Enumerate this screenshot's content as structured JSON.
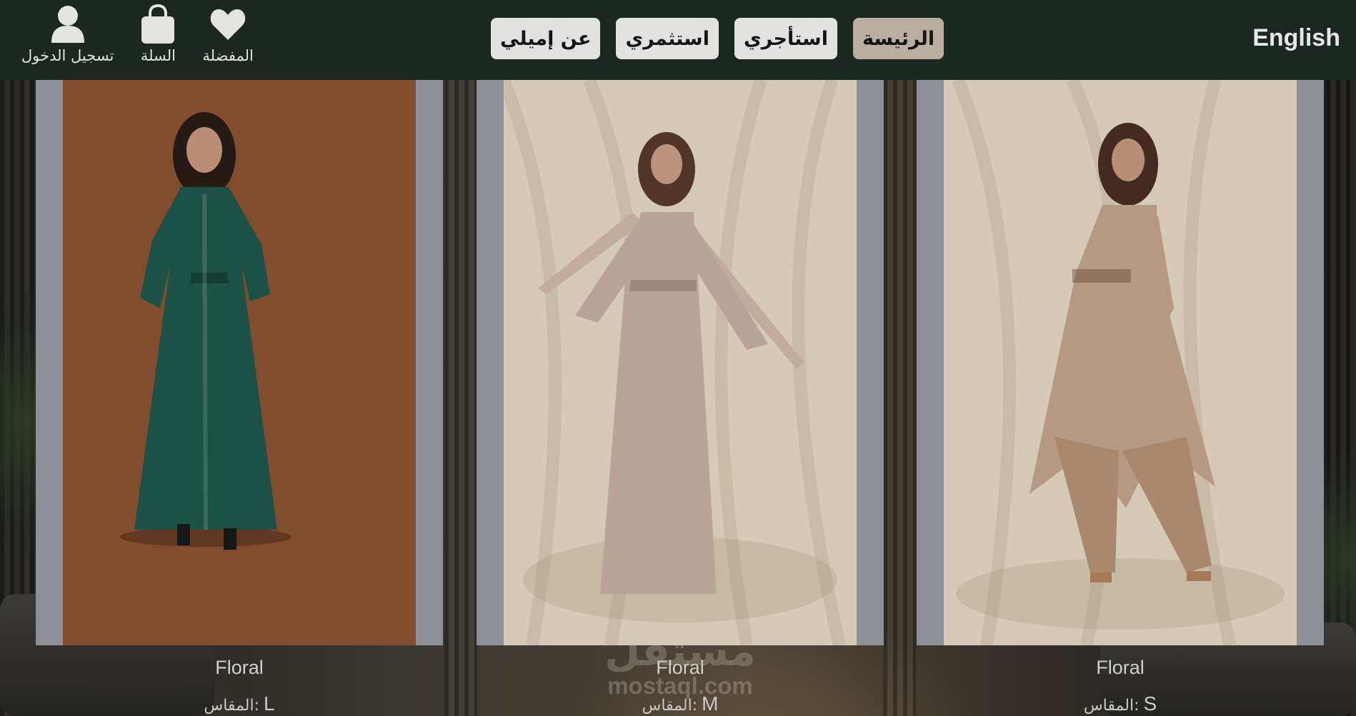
{
  "nav": {
    "favorites_label": "المفضلة",
    "cart_label": "السلة",
    "login_label": "تسجيل الدخول",
    "buttons": [
      {
        "label": "عن إميلي"
      },
      {
        "label": "استثمري"
      },
      {
        "label": "استأجري"
      },
      {
        "label": "الرئيسة"
      }
    ],
    "active_button": "الرئيسة",
    "language_toggle": "English"
  },
  "products": [
    {
      "name": "Floral",
      "size_label": "المقاس:",
      "size": "L",
      "dress_color": "#1f5a4c",
      "backdrop": "#8e5334"
    },
    {
      "name": "Floral",
      "size_label": "المقاس:",
      "size": "M",
      "dress_color": "#c9b3a4",
      "backdrop": "#e7dcc6"
    },
    {
      "name": "Floral",
      "size_label": "المقاس:",
      "size": "S",
      "dress_color": "#c6a78e",
      "backdrop": "#e7dcc6"
    }
  ],
  "watermark": {
    "arabic": "مستقل",
    "latin": "mostaql.com"
  },
  "colors": {
    "navbar": "#1d2722",
    "button": "#e2e2e0",
    "button_active": "#b8aea2",
    "card_frame": "#9a9da3"
  },
  "icons": [
    "heart-icon",
    "shopping-bag-icon",
    "user-icon"
  ]
}
